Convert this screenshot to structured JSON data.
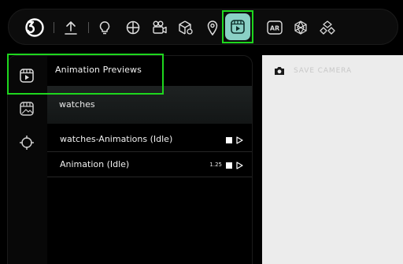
{
  "toolbar": {
    "logo": "3d-logo-icon",
    "items": [
      {
        "icon": "upload-icon"
      },
      {
        "icon": "lightbulb-icon"
      },
      {
        "icon": "globe-icon"
      },
      {
        "icon": "camera-rig-icon"
      },
      {
        "icon": "box-settings-icon"
      },
      {
        "icon": "map-pin-icon"
      },
      {
        "icon": "animation-preview-icon",
        "active": true
      },
      {
        "icon": "ar-icon",
        "label": "AR"
      },
      {
        "icon": "atom-icon"
      },
      {
        "icon": "shapes-icon"
      }
    ],
    "accent": "#8ad0c5",
    "highlight": "#1ed61e"
  },
  "side_rail": {
    "items": [
      {
        "icon": "animation-preview-icon",
        "active": true
      },
      {
        "icon": "image-preview-icon"
      },
      {
        "icon": "crosshair-icon"
      }
    ]
  },
  "panel": {
    "title": "Animation Previews",
    "model_name": "watches",
    "animations": [
      {
        "label": "watches-Animations (Idle)",
        "speed": ""
      },
      {
        "label": "Animation (Idle)",
        "speed": "1.25"
      }
    ]
  },
  "viewer": {
    "save_camera_label": "SAVE CAMERA"
  }
}
